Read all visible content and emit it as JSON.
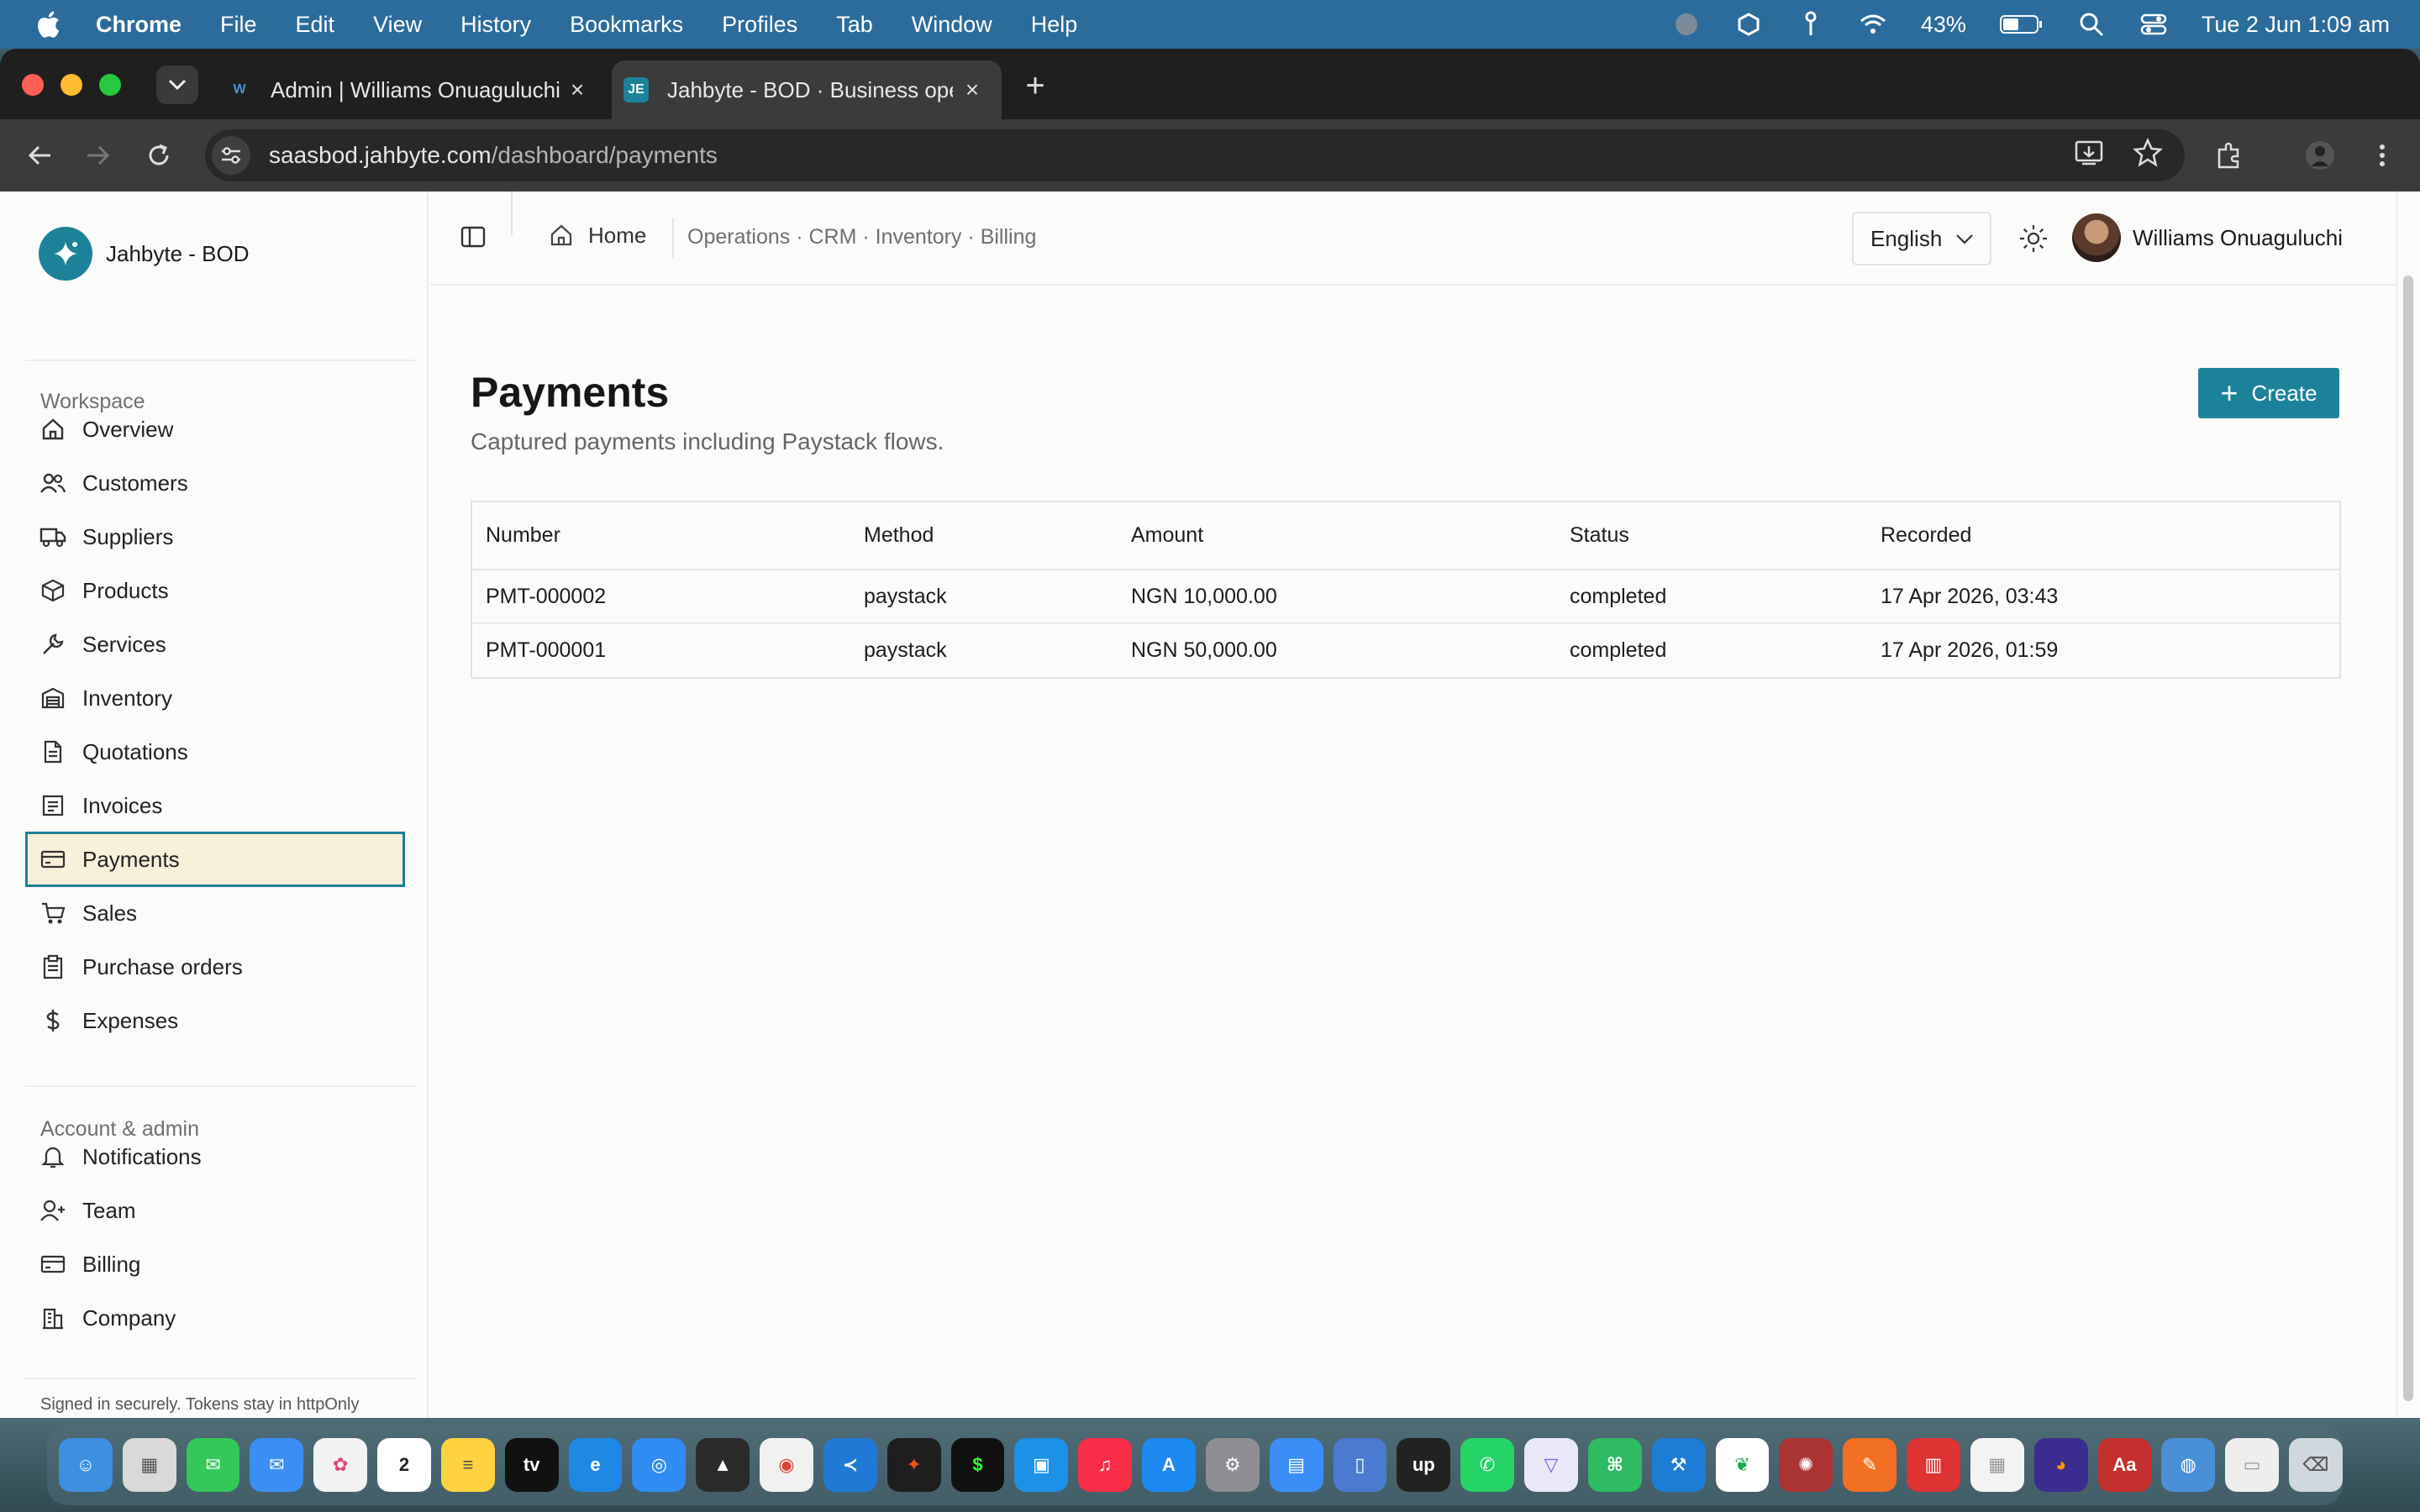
{
  "menubar": {
    "app_name": "Chrome",
    "items": [
      "File",
      "Edit",
      "View",
      "History",
      "Bookmarks",
      "Profiles",
      "Tab",
      "Window",
      "Help"
    ],
    "battery": "43%",
    "datetime": "Tue 2 Jun  1:09 am"
  },
  "browser": {
    "tabs": [
      {
        "title": "Admin | Williams Onuaguluchi",
        "favicon": "W",
        "active": false
      },
      {
        "title": "Jahbyte - BOD · Business ope",
        "favicon": "JE",
        "active": true
      }
    ],
    "url_host": "saasbod.jahbyte.com",
    "url_path": "/dashboard/payments"
  },
  "sidebar": {
    "brand": "Jahbyte - BOD",
    "workspace_label": "Workspace",
    "workspace_items": [
      {
        "label": "Overview",
        "icon": "home-icon"
      },
      {
        "label": "Customers",
        "icon": "users-icon"
      },
      {
        "label": "Suppliers",
        "icon": "truck-icon"
      },
      {
        "label": "Products",
        "icon": "package-icon"
      },
      {
        "label": "Services",
        "icon": "wrench-icon"
      },
      {
        "label": "Inventory",
        "icon": "warehouse-icon"
      },
      {
        "label": "Quotations",
        "icon": "document-icon"
      },
      {
        "label": "Invoices",
        "icon": "receipt-icon"
      },
      {
        "label": "Payments",
        "icon": "credit-card-icon",
        "active": true
      },
      {
        "label": "Sales",
        "icon": "cart-icon"
      },
      {
        "label": "Purchase orders",
        "icon": "clipboard-icon"
      },
      {
        "label": "Expenses",
        "icon": "dollar-icon"
      }
    ],
    "admin_label": "Account & admin",
    "admin_items": [
      {
        "label": "Notifications",
        "icon": "bell-icon"
      },
      {
        "label": "Team",
        "icon": "user-plus-icon"
      },
      {
        "label": "Billing",
        "icon": "card-icon"
      },
      {
        "label": "Company",
        "icon": "building-icon"
      }
    ],
    "footer": "Signed in securely. Tokens stay in httpOnly cookies."
  },
  "header": {
    "home": "Home",
    "breadcrumb": "Operations · CRM · Inventory · Billing",
    "language": "English",
    "user_name": "Williams Onuaguluchi"
  },
  "main": {
    "title": "Payments",
    "subtitle": "Captured payments including Paystack flows.",
    "create_label": "Create",
    "columns": [
      "Number",
      "Method",
      "Amount",
      "Status",
      "Recorded"
    ],
    "rows": [
      [
        "PMT-000002",
        "paystack",
        "NGN 10,000.00",
        "completed",
        "17 Apr 2026, 03:43"
      ],
      [
        "PMT-000001",
        "paystack",
        "NGN 50,000.00",
        "completed",
        "17 Apr 2026, 01:59"
      ]
    ]
  },
  "colors": {
    "accent": "#1b8299",
    "active_bg": "#f8f0d8",
    "menubar": "#2b6c9c"
  }
}
